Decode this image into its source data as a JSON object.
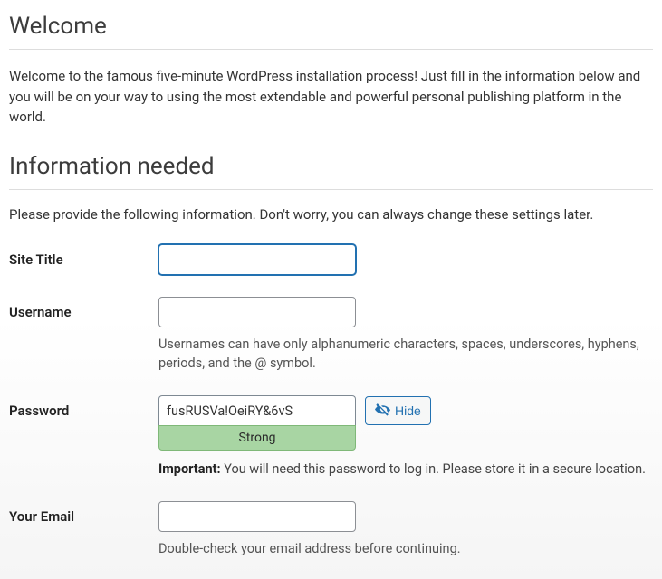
{
  "headings": {
    "welcome": "Welcome",
    "info_needed": "Information needed"
  },
  "intro": "Welcome to the famous five-minute WordPress installation process! Just fill in the information below and you will be on your way to using the most extendable and powerful personal publishing platform in the world.",
  "info_prompt": "Please provide the following information. Don't worry, you can always change these settings later.",
  "fields": {
    "site_title": {
      "label": "Site Title",
      "value": ""
    },
    "username": {
      "label": "Username",
      "value": "",
      "hint": "Usernames can have only alphanumeric characters, spaces, underscores, hyphens, periods, and the @ symbol."
    },
    "password": {
      "label": "Password",
      "value": "fusRUSVa!OeiRY&6vS",
      "strength_label": "Strong",
      "hide_button": "Hide",
      "important_prefix": "Important:",
      "important_text": " You will need this password to log in. Please store it in a secure location."
    },
    "email": {
      "label": "Your Email",
      "value": "",
      "hint": "Double-check your email address before continuing."
    }
  }
}
